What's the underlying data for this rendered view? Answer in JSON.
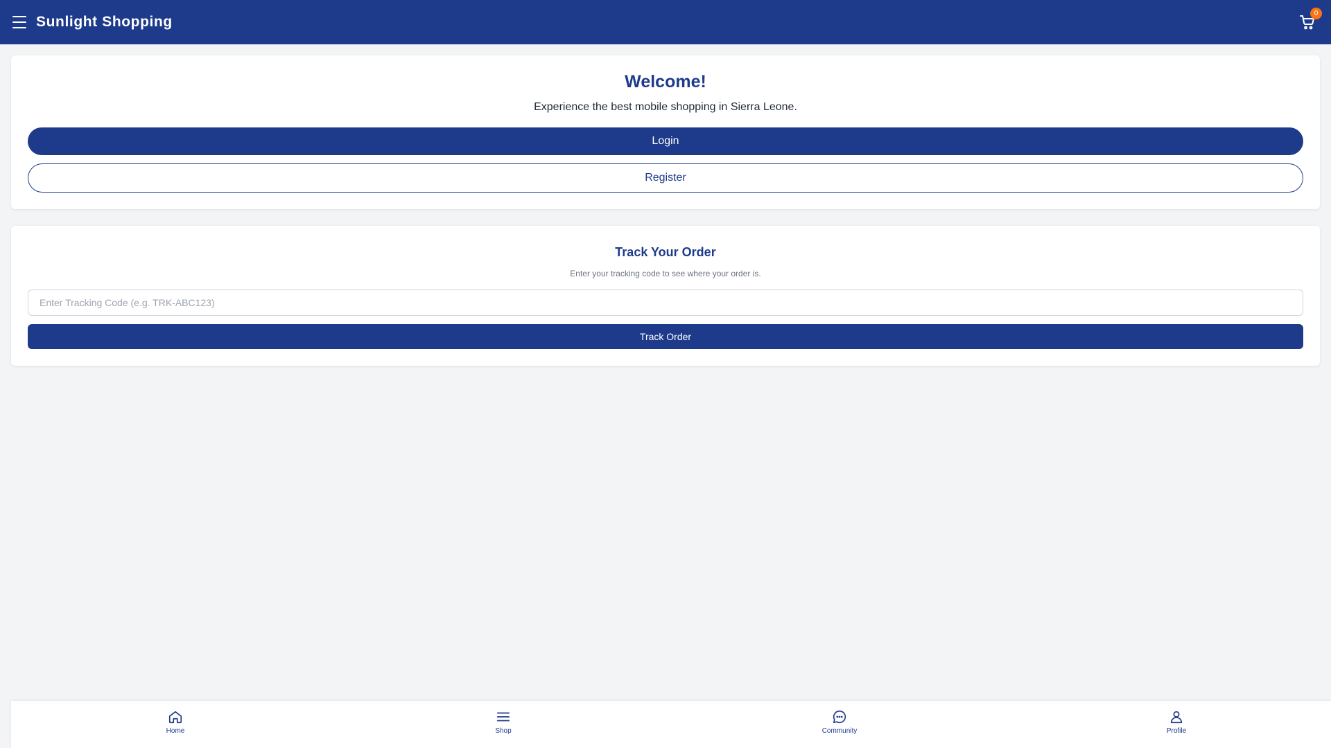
{
  "header": {
    "title": "Sunlight Shopping",
    "cart_count": "0",
    "menu_icon": "hamburger-icon",
    "cart_icon": "cart-icon"
  },
  "welcome": {
    "title": "Welcome!",
    "subtitle": "Experience the best mobile shopping in Sierra Leone.",
    "login_label": "Login",
    "register_label": "Register"
  },
  "tracking": {
    "title": "Track Your Order",
    "subtitle": "Enter your tracking code to see where your order is.",
    "placeholder": "Enter Tracking Code (e.g. TRK-ABC123)",
    "value": "",
    "button_label": "Track Order"
  },
  "bottom_nav": {
    "items": [
      {
        "label": "Home",
        "icon": "home-icon"
      },
      {
        "label": "Shop",
        "icon": "list-icon"
      },
      {
        "label": "Community",
        "icon": "chat-icon"
      },
      {
        "label": "Profile",
        "icon": "user-icon"
      }
    ]
  },
  "colors": {
    "primary": "#1e3a8a",
    "badge": "#f97316",
    "background": "#f3f4f6"
  }
}
